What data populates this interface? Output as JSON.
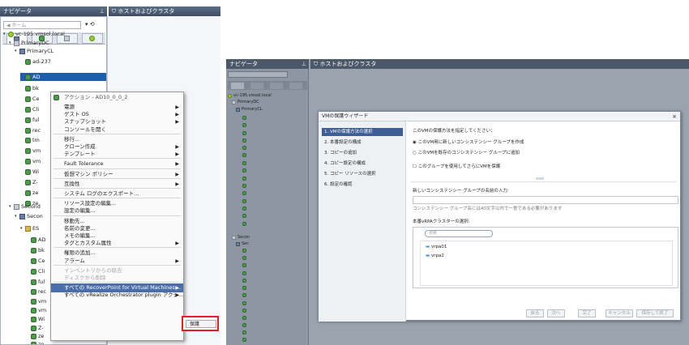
{
  "left": {
    "navigator_title": "ナビゲータ",
    "pin_icon": "pin-icon",
    "hosts_title": "ホストおよびクラスタ",
    "back_label": "ホーム",
    "tree": [
      {
        "label": "vc-195.vmsol.local",
        "icon": "vcenter-icon"
      },
      {
        "label": "PrimaryDC",
        "icon": "datacenter-icon"
      },
      {
        "label": "PrimaryCL",
        "icon": "cluster-icon"
      },
      {
        "label": "ad-237",
        "icon": "vm-icon"
      },
      {
        "label": "AD",
        "icon": "vm-icon"
      },
      {
        "label": "bk",
        "icon": "vm-icon"
      },
      {
        "label": "Ce",
        "icon": "vm-icon"
      },
      {
        "label": "Cli",
        "icon": "vm-icon"
      },
      {
        "label": "ful",
        "icon": "vm-icon"
      },
      {
        "label": "rec",
        "icon": "vm-icon"
      },
      {
        "label": "tm",
        "icon": "vm-icon"
      },
      {
        "label": "vm",
        "icon": "vm-icon"
      },
      {
        "label": "vm",
        "icon": "vm-icon"
      },
      {
        "label": "Wi",
        "icon": "vm-icon"
      },
      {
        "label": "Z-",
        "icon": "vm-icon"
      },
      {
        "label": "ze",
        "icon": "vm-icon"
      },
      {
        "label": "ze",
        "icon": "vm-icon"
      },
      {
        "label": "Second",
        "icon": "datacenter-icon"
      },
      {
        "label": "Secon",
        "icon": "cluster-icon"
      },
      {
        "label": "ES",
        "icon": "host-icon"
      },
      {
        "label": "AD",
        "icon": "vm-icon"
      },
      {
        "label": "bk",
        "icon": "vm-icon"
      },
      {
        "label": "Ce",
        "icon": "vm-icon"
      },
      {
        "label": "Cli",
        "icon": "vm-icon"
      },
      {
        "label": "ful",
        "icon": "vm-icon"
      },
      {
        "label": "rec",
        "icon": "vm-icon"
      },
      {
        "label": "vm",
        "icon": "vm-icon"
      },
      {
        "label": "vm",
        "icon": "vm-icon"
      },
      {
        "label": "Wi",
        "icon": "vm-icon"
      },
      {
        "label": "Z-",
        "icon": "vm-icon"
      },
      {
        "label": "ze",
        "icon": "vm-icon"
      },
      {
        "label": "ze",
        "icon": "vm-icon"
      }
    ],
    "menu_header": "アクション - AD10_0_0_2",
    "menu": [
      {
        "label": "電源",
        "arrow": true
      },
      {
        "label": "ゲスト OS",
        "arrow": true
      },
      {
        "label": "スナップショット",
        "arrow": true
      },
      {
        "label": "コンソールを開く",
        "arrow": false
      },
      {
        "sep": true
      },
      {
        "label": "移行...",
        "arrow": false
      },
      {
        "label": "クローン作成",
        "arrow": true
      },
      {
        "label": "テンプレート",
        "arrow": true
      },
      {
        "sep": true
      },
      {
        "label": "Fault Tolerance",
        "arrow": true
      },
      {
        "sep": true
      },
      {
        "label": "仮想マシン ポリシー",
        "arrow": true
      },
      {
        "sep": true
      },
      {
        "label": "互換性",
        "arrow": true
      },
      {
        "sep": true
      },
      {
        "label": "システム ログのエクスポート...",
        "arrow": false
      },
      {
        "sep": true
      },
      {
        "label": "リソース設定の編集...",
        "arrow": false
      },
      {
        "label": "設定の編集...",
        "arrow": false
      },
      {
        "sep": true
      },
      {
        "label": "移動先...",
        "arrow": false
      },
      {
        "label": "名前の変更...",
        "arrow": false
      },
      {
        "label": "メモの編集...",
        "arrow": false
      },
      {
        "label": "タグとカスタム属性",
        "arrow": true
      },
      {
        "sep": true
      },
      {
        "label": "権限の追加...",
        "arrow": false
      },
      {
        "label": "アラーム",
        "arrow": true
      },
      {
        "sep": true
      },
      {
        "label": "インベントリからの除去",
        "arrow": false,
        "disabled": true
      },
      {
        "label": "ディスクから削除",
        "arrow": false,
        "disabled": true
      },
      {
        "sep": true
      },
      {
        "label": "すべての RecoverPoint for Virtual Machines ...",
        "arrow": true,
        "selected": true
      },
      {
        "label": "すべての vRealize Orchestrator plugin アクシ...",
        "arrow": true
      }
    ],
    "submenu_item": "保護",
    "highlight_color": "#e02020"
  },
  "right": {
    "navigator_title": "ナビゲータ",
    "hosts_title": "ホストおよびクラスタ",
    "tree": [
      {
        "label": "vc-195.vmsol.local",
        "icon": "vcenter-icon"
      },
      {
        "label": "PrimaryDC",
        "icon": "datacenter-icon"
      },
      {
        "label": "PrimaryCL",
        "icon": "cluster-icon"
      },
      {
        "label": "Secon",
        "icon": "datacenter-icon"
      },
      {
        "label": "Sec",
        "icon": "cluster-icon"
      }
    ],
    "wizard": {
      "title": "VMの保護ウィザード",
      "steps": [
        "1. VMの保護方法の選択",
        "2. 本番設定の構成",
        "3. コピーの追加",
        "4. コピー設定の構成",
        "5. コピー リソースの選択",
        "6. 設定の確認"
      ],
      "prompt": "このVMの保護方法を指定してください：",
      "options": [
        "このVM用に新しいコンシステンシー グループを作成",
        "このVMを既存のコンシステンシー グループに追加"
      ],
      "checkbox_label": "このグループを使用してさらにVMを保護",
      "cg_name_label": "新しいコンシステンシー グループの名前の入力:",
      "cg_name_hint": "コンシステンシー グループ名には40文字以内で一意である必要があります",
      "cluster_label": "本番vRPAクラスターの選択:",
      "filter_placeholder": "検索",
      "clusters": [
        "vrpa01",
        "vrpa2"
      ],
      "buttons": [
        "戻る",
        "次へ",
        "完了",
        "キャンセル",
        "保存して終了"
      ]
    }
  }
}
